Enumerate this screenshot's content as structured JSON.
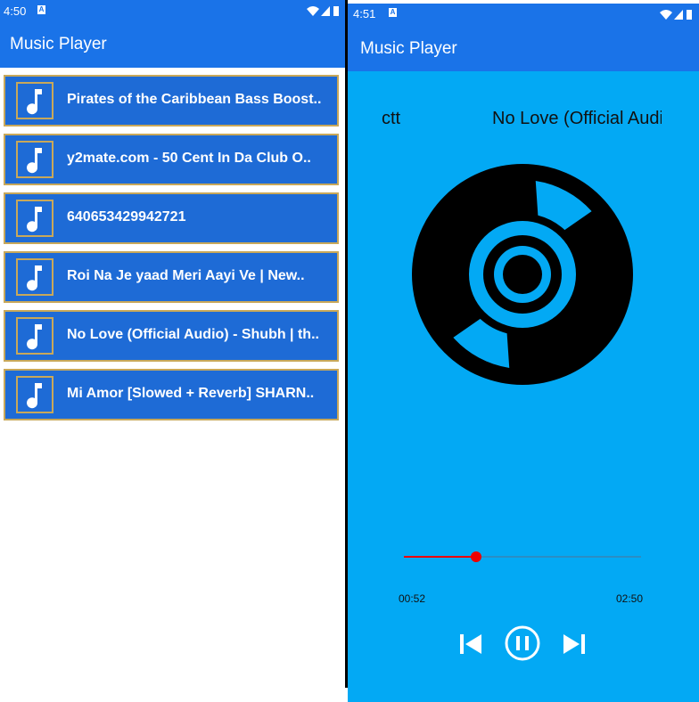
{
  "left_screen": {
    "status_time": "4:50",
    "app_title": "Music Player",
    "songs": [
      {
        "title": "Pirates of the Caribbean Bass Boost.."
      },
      {
        "title": "y2mate.com - 50 Cent  In Da Club O.."
      },
      {
        "title": "640653429942721"
      },
      {
        "title": "Roi Na Je yaad Meri Aayi Ve | New.."
      },
      {
        "title": "No Love (Official Audio) - Shubh | th.."
      },
      {
        "title": "Mi Amor [Slowed + Reverb] SHARN.."
      }
    ]
  },
  "right_screen": {
    "status_time": "4:51",
    "app_title": "Music Player",
    "marquee_left": "ctt",
    "now_playing_title": "No Love (Official Audio)",
    "current_time": "00:52",
    "total_time": "02:50",
    "progress": 0.306
  },
  "colors": {
    "primary": "#1a73e8",
    "list_item_bg": "#1e6bd6",
    "list_border": "#c8a85a",
    "player_bg": "#03a9f4",
    "progress": "#e00000"
  },
  "icons": [
    "music-note-icon",
    "wifi-icon",
    "signal-icon",
    "battery-icon",
    "skip-previous-icon",
    "pause-icon",
    "skip-next-icon",
    "disc-icon"
  ]
}
